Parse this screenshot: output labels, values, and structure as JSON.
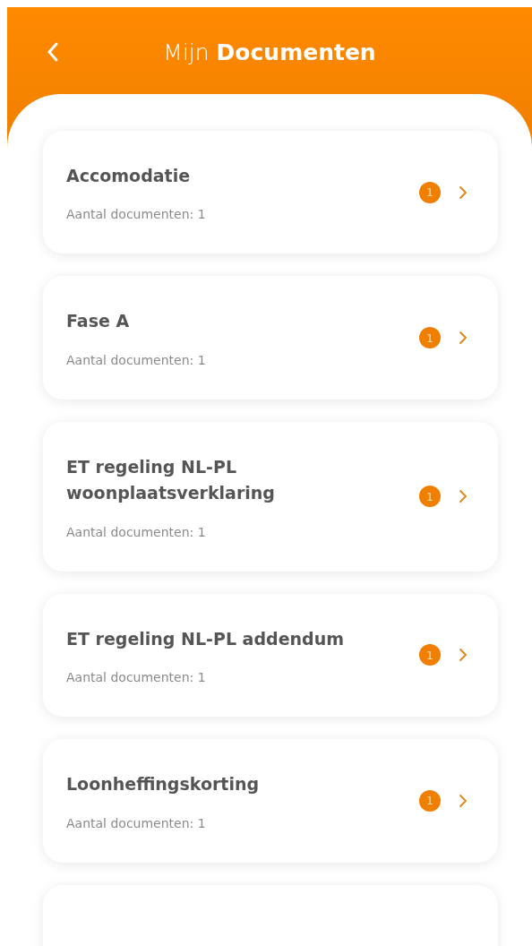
{
  "header": {
    "title": "Mijn **Documenten**"
  },
  "folders": [
    {
      "title": "Accomodatie",
      "subtitle": "Aantal documenten: 1",
      "badge": "1"
    },
    {
      "title": "Fase A",
      "subtitle": "Aantal documenten: 1",
      "badge": "1"
    },
    {
      "title": "ET regeling NL-PL woonplaatsverklaring",
      "subtitle": "Aantal documenten: 1",
      "badge": "1"
    },
    {
      "title": "ET regeling NL-PL addendum",
      "subtitle": "Aantal documenten: 1",
      "badge": "1"
    },
    {
      "title": "Loonheffingskorting",
      "subtitle": "Aantal documenten: 1",
      "badge": "1"
    }
  ]
}
